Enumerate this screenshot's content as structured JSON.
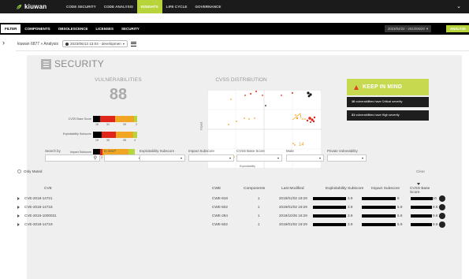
{
  "nav": {
    "brand": "kiuwan",
    "tabs": [
      {
        "label": "CODE SECURITY",
        "active": false
      },
      {
        "label": "CODE ANALYSIS",
        "active": false
      },
      {
        "label": "INSIGHTS",
        "active": true
      },
      {
        "label": "LIFE CYCLE",
        "active": false
      },
      {
        "label": "GOVERNANCE",
        "active": false
      }
    ],
    "account_icon": "chevron-down-icon"
  },
  "subnav": {
    "filter_label": "FILTER",
    "tabs": [
      "COMPONENTS",
      "OBSOLESCENCE",
      "LICENSES",
      "SECURITY"
    ],
    "date_range": "2023/04/22 - 2023/06/20",
    "analyze_label": "ANALYZE"
  },
  "breadcrumb": {
    "text": "kiuwan 6877 » Analysis",
    "snapshot": "2023/06/13 13:04 - developmen"
  },
  "section": {
    "title": "SECURITY"
  },
  "vulnerabilities": {
    "heading": "VULNERABILITIES",
    "count": "88",
    "rows": [
      {
        "label": "CVSS Base Score",
        "nums": [
          "16",
          "31",
          "39",
          "2"
        ]
      },
      {
        "label": "Exploitability Subscore",
        "nums": [
          "19",
          "30",
          "35",
          "4"
        ]
      },
      {
        "label": "Impact Subscore",
        "nums": [
          "15",
          "3",
          "50",
          "13"
        ]
      }
    ],
    "colors": {
      "critical": "#000000",
      "high": "#e0261b",
      "medium": "#f0a623",
      "low": "#b6d63b"
    }
  },
  "cvss": {
    "heading": "CVSS DISTRIBUTION",
    "ylabel": "Impact",
    "xlabel": "Exploitability",
    "point_labels": [
      "12",
      "14"
    ]
  },
  "keep_in_mind": {
    "heading": "KEEP IN MIND",
    "items": [
      {
        "num": "16",
        "text": "vulnerabilities have Critical severity"
      },
      {
        "num": "31",
        "text": "vulnerabilities have High severity"
      }
    ]
  },
  "filters": {
    "search_label": "Search by",
    "is_new_label": "Is new?",
    "exploitability_label": "Exploitability Subscore",
    "impact_label": "Impact Subscore",
    "cvss_label": "CVSS Base Score",
    "mute_label": "Mute",
    "private_label": "Private Vulnerability",
    "only_muted": "Only Muted",
    "clear": "Clear"
  },
  "table": {
    "headers": {
      "cve": "CVE",
      "cwe": "CWE",
      "components": "Components",
      "last_modified": "Last Modified",
      "exploitability": "Exploitability Subscore",
      "impact": "Impact Subscore",
      "cvss": "CVSS Base Score"
    },
    "rows": [
      {
        "cve": "CVE-2018-14721",
        "cwe": "CWE-918",
        "components": "1",
        "last_modified": "2019/01/02 19:29",
        "exploitability": "3.9",
        "impact": "6",
        "cvss": "10"
      },
      {
        "cve": "CVE-2018-14718",
        "cwe": "CWE-502",
        "components": "1",
        "last_modified": "2019/01/02 19:29",
        "exploitability": "3.9",
        "impact": "5.9",
        "cvss": "9.8"
      },
      {
        "cve": "CVE-2016-1000031",
        "cwe": "CWE-284",
        "components": "1",
        "last_modified": "2019/10/26 16:29",
        "exploitability": "3.9",
        "impact": "5.9",
        "cvss": "9.8"
      },
      {
        "cve": "CVE-2018-14719",
        "cwe": "CWE-502",
        "components": "1",
        "last_modified": "2019/01/02 19:29",
        "exploitability": "3.9",
        "impact": "5.9",
        "cvss": "9.8"
      }
    ]
  }
}
